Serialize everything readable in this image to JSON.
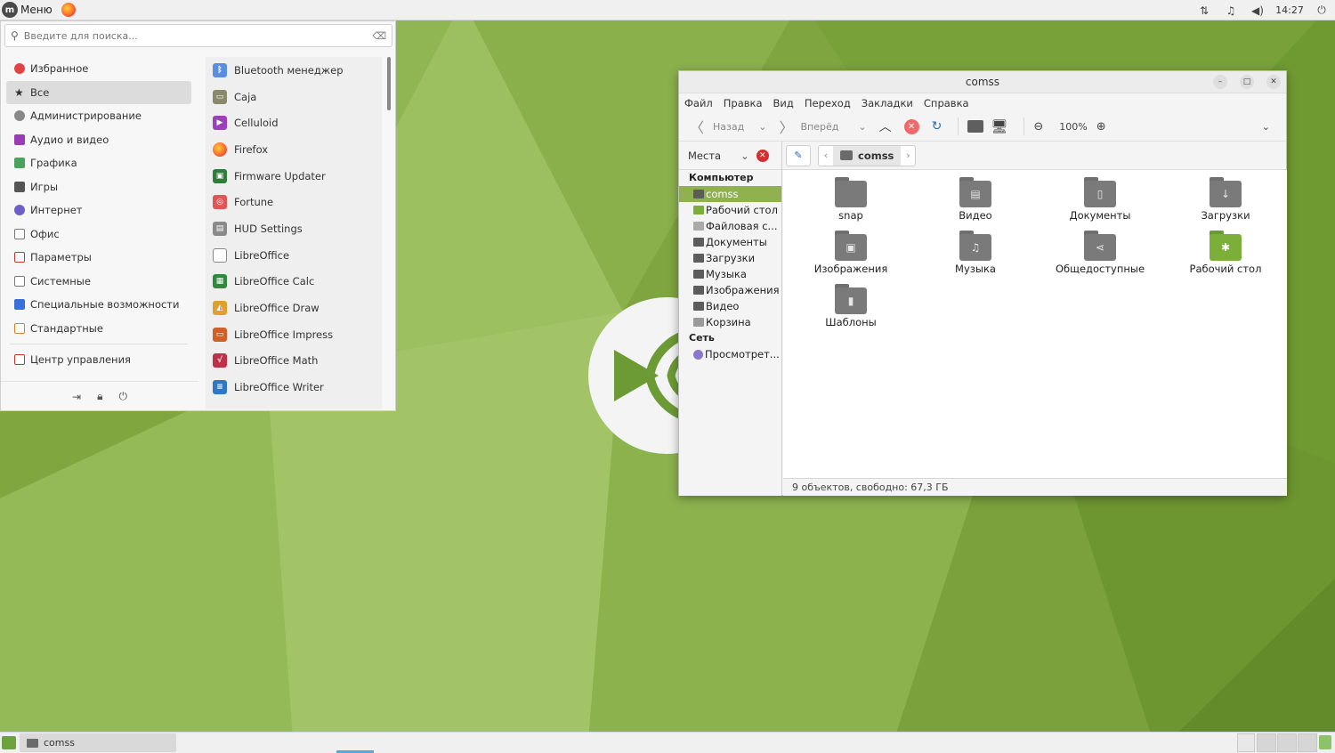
{
  "top_panel": {
    "menu_label": "Меню",
    "clock": "14:27",
    "tray_icons": [
      "network-icon",
      "bell-icon",
      "volume-icon",
      "power-icon"
    ]
  },
  "app_menu": {
    "search_placeholder": "Введите для поиска...",
    "categories": [
      {
        "label": "Избранное",
        "color": "#e04444"
      },
      {
        "label": "Все",
        "color": "#333333",
        "selected": true
      },
      {
        "label": "Администрирование",
        "color": "#888888"
      },
      {
        "label": "Аудио и видео",
        "color": "#9b3bb5"
      },
      {
        "label": "Графика",
        "color": "#4aa35a"
      },
      {
        "label": "Игры",
        "color": "#555555"
      },
      {
        "label": "Интернет",
        "color": "#6f5fc8"
      },
      {
        "label": "Офис",
        "color": "#777777"
      },
      {
        "label": "Параметры",
        "color": "#c0392b"
      },
      {
        "label": "Системные",
        "color": "#7a7a7a"
      },
      {
        "label": "Специальные возможности",
        "color": "#3a6fd8"
      },
      {
        "label": "Стандартные",
        "color": "#d9822b"
      }
    ],
    "control_center": "Центр управления",
    "apps": [
      {
        "label": "Bluetooth менеджер",
        "color": "#5b8de0",
        "glyph": "ᛒ"
      },
      {
        "label": "Caja",
        "color": "#8a8a6a",
        "glyph": "▭"
      },
      {
        "label": "Celluloid",
        "color": "#9c3fb8",
        "glyph": "▶"
      },
      {
        "label": "Firefox",
        "color": "#ff7a2b",
        "glyph": "●"
      },
      {
        "label": "Firmware Updater",
        "color": "#2f7d3a",
        "glyph": "▣"
      },
      {
        "label": "Fortune",
        "color": "#e05555",
        "glyph": "◎"
      },
      {
        "label": "HUD Settings",
        "color": "#8a8a8a",
        "glyph": "▤"
      },
      {
        "label": "LibreOffice",
        "color": "#dddddd",
        "glyph": ""
      },
      {
        "label": "LibreOffice Calc",
        "color": "#2e8b3c",
        "glyph": "▦"
      },
      {
        "label": "LibreOffice Draw",
        "color": "#e0a030",
        "glyph": "◭"
      },
      {
        "label": "LibreOffice Impress",
        "color": "#d0602a",
        "glyph": "▭"
      },
      {
        "label": "LibreOffice Math",
        "color": "#c0304a",
        "glyph": "√"
      },
      {
        "label": "LibreOffice Writer",
        "color": "#2f78c4",
        "glyph": "≡"
      }
    ],
    "footer_icons": [
      "lock-screen-icon",
      "lock-icon",
      "power-icon"
    ]
  },
  "caja": {
    "title": "comss",
    "menu": [
      "Файл",
      "Правка",
      "Вид",
      "Переход",
      "Закладки",
      "Справка"
    ],
    "toolbar": {
      "back": "Назад",
      "forward": "Вперёд",
      "zoom": "100%"
    },
    "places_label": "Места",
    "current_folder": "comss",
    "sidebar": {
      "computer_header": "Компьютер",
      "computer_items": [
        {
          "label": "comss",
          "selected": true
        },
        {
          "label": "Рабочий стол"
        },
        {
          "label": "Файловая с..."
        },
        {
          "label": "Документы"
        },
        {
          "label": "Загрузки"
        },
        {
          "label": "Музыка"
        },
        {
          "label": "Изображения"
        },
        {
          "label": "Видео"
        },
        {
          "label": "Корзина"
        }
      ],
      "network_header": "Сеть",
      "network_items": [
        {
          "label": "Просмотрет..."
        }
      ]
    },
    "files": [
      {
        "label": "snap",
        "glyph": "",
        "green": false
      },
      {
        "label": "Видео",
        "glyph": "▤",
        "green": false
      },
      {
        "label": "Документы",
        "glyph": "▯",
        "green": false
      },
      {
        "label": "Загрузки",
        "glyph": "↓",
        "green": false
      },
      {
        "label": "Изображения",
        "glyph": "▣",
        "green": false
      },
      {
        "label": "Музыка",
        "glyph": "♫",
        "green": false
      },
      {
        "label": "Общедоступные",
        "glyph": "⋖",
        "green": false
      },
      {
        "label": "Рабочий стол",
        "glyph": "✱",
        "green": true
      },
      {
        "label": "Шаблоны",
        "glyph": "▮",
        "green": false
      }
    ],
    "status": "9 объектов, свободно: 67,3 ГБ"
  },
  "taskbar": {
    "task_label": "comss"
  }
}
